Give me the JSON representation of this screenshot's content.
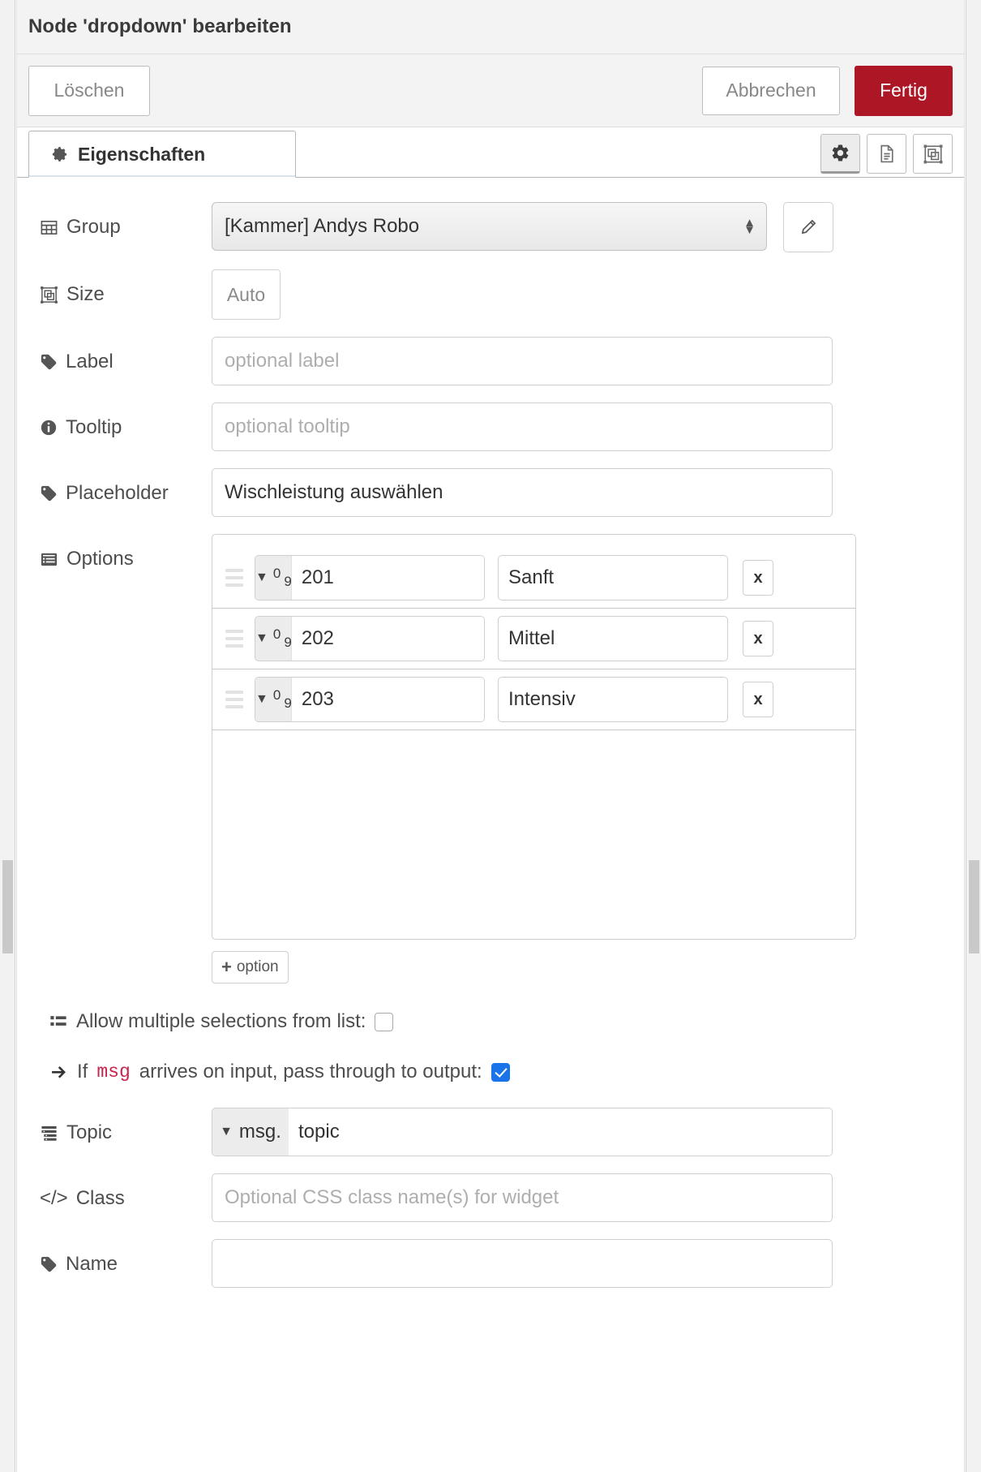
{
  "window": {
    "title": "Node 'dropdown' bearbeiten"
  },
  "actions": {
    "delete_label": "Löschen",
    "cancel_label": "Abbrechen",
    "done_label": "Fertig",
    "done_color": "#ad1625"
  },
  "tabs": {
    "properties_label": "Eigenschaften",
    "tools": [
      {
        "name": "properties-tool",
        "icon": "gear-icon",
        "active": true
      },
      {
        "name": "description-tool",
        "icon": "document-icon",
        "active": false
      },
      {
        "name": "appearance-tool",
        "icon": "appearance-icon",
        "active": false
      }
    ]
  },
  "form": {
    "group": {
      "label": "Group",
      "icon": "table-icon",
      "value": "[Kammer] Andys Robo",
      "edit_icon": "pencil-icon"
    },
    "size": {
      "label": "Size",
      "icon": "resize-icon",
      "value": "Auto"
    },
    "widget_label": {
      "label": "Label",
      "icon": "tag-icon",
      "value": "",
      "placeholder": "optional label"
    },
    "tooltip": {
      "label": "Tooltip",
      "icon": "info-icon",
      "value": "",
      "placeholder": "optional tooltip"
    },
    "placeholder": {
      "label": "Placeholder",
      "icon": "tag-icon",
      "value": "Wischleistung auswählen",
      "placeholder": ""
    },
    "options": {
      "label": "Options",
      "icon": "list-icon",
      "type_label": "num",
      "remove_label": "x",
      "add_label": "option",
      "add_plus": "+",
      "rows": [
        {
          "type": "num",
          "value": "201",
          "label": "Sanft"
        },
        {
          "type": "num",
          "value": "202",
          "label": "Mittel"
        },
        {
          "type": "num",
          "value": "203",
          "label": "Intensiv"
        }
      ]
    },
    "multiple": {
      "icon": "list-ul-icon",
      "text": "Allow multiple selections from list:",
      "checked": false
    },
    "passthrough": {
      "icon": "arrow-right-icon",
      "text_before": "If",
      "msg_token": "msg",
      "text_after": "arrives on input, pass through to output:",
      "checked": true
    },
    "topic": {
      "label": "Topic",
      "icon": "topic-icon",
      "type_prefix": "msg.",
      "value": "topic"
    },
    "css_class": {
      "label": "Class",
      "icon": "code-icon",
      "value": "",
      "placeholder": "Optional CSS class name(s) for widget"
    },
    "name": {
      "label": "Name",
      "icon": "tag-icon",
      "value": "",
      "placeholder": ""
    }
  }
}
